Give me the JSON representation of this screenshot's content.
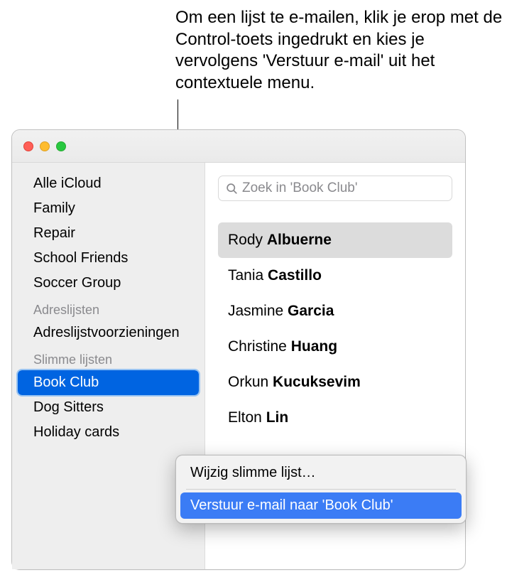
{
  "callout": "Om een lijst te e-mailen, klik je erop met de Control-toets ingedrukt en kies je vervolgens 'Verstuur e-mail' uit het contextuele menu.",
  "sidebar": {
    "groups": [
      {
        "items": [
          {
            "label": "Alle iCloud",
            "selected": false
          },
          {
            "label": "Family",
            "selected": false
          },
          {
            "label": "Repair",
            "selected": false
          },
          {
            "label": "School Friends",
            "selected": false
          },
          {
            "label": "Soccer Group",
            "selected": false
          }
        ]
      },
      {
        "header": "Adreslijsten",
        "items": [
          {
            "label": "Adreslijstvoorzieningen",
            "selected": false
          }
        ]
      },
      {
        "header": "Slimme lijsten",
        "items": [
          {
            "label": "Book Club",
            "selected": true
          },
          {
            "label": "Dog Sitters",
            "selected": false
          },
          {
            "label": "Holiday cards",
            "selected": false
          }
        ]
      }
    ]
  },
  "search": {
    "placeholder": "Zoek in 'Book Club'"
  },
  "contacts": [
    {
      "first": "Rody",
      "last": "Albuerne",
      "selected": true
    },
    {
      "first": "Tania",
      "last": "Castillo",
      "selected": false
    },
    {
      "first": "Jasmine",
      "last": "Garcia",
      "selected": false
    },
    {
      "first": "Christine",
      "last": "Huang",
      "selected": false
    },
    {
      "first": "Orkun",
      "last": "Kucuksevim",
      "selected": false
    },
    {
      "first": "Elton",
      "last": "Lin",
      "selected": false
    }
  ],
  "contextMenu": {
    "items": [
      {
        "label": "Wijzig slimme lijst…",
        "highlighted": false
      },
      {
        "label": "Verstuur e-mail naar 'Book Club'",
        "highlighted": true
      }
    ]
  }
}
